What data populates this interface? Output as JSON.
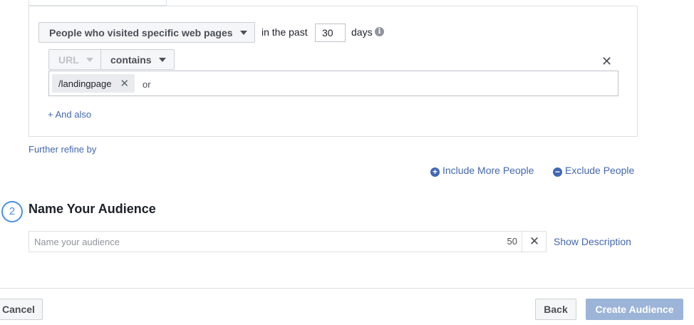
{
  "rule": {
    "audience_source_label": "People who visited specific web pages",
    "in_the_past_label": "in the past",
    "days_value": "30",
    "days_label": "days",
    "info_glyph": "i",
    "url_dropdown_label": "URL",
    "operator_label": "contains",
    "close_glyph": "✕",
    "url_tokens": [
      "/landingpage"
    ],
    "token_remove_glyph": "✕",
    "or_label": "or",
    "and_also_label": "+ And also"
  },
  "refine": {
    "further_refine_label": "Further refine by",
    "include_more_label": "Include More People",
    "exclude_label": "Exclude People"
  },
  "name_section": {
    "step_number": "2",
    "title": "Name Your Audience",
    "input_placeholder": "Name your audience",
    "input_value": "",
    "char_count": "50",
    "clear_glyph": "✕",
    "show_description_label": "Show Description"
  },
  "footer": {
    "cancel_label": "Cancel",
    "back_label": "Back",
    "create_label": "Create Audience"
  },
  "colors": {
    "link": "#4267b2",
    "step_accent": "#4a90e2",
    "primary_disabled": "#9cb4d8"
  },
  "icons": {
    "include": "plus-circle-icon",
    "exclude": "minus-circle-icon",
    "info": "info-icon"
  }
}
